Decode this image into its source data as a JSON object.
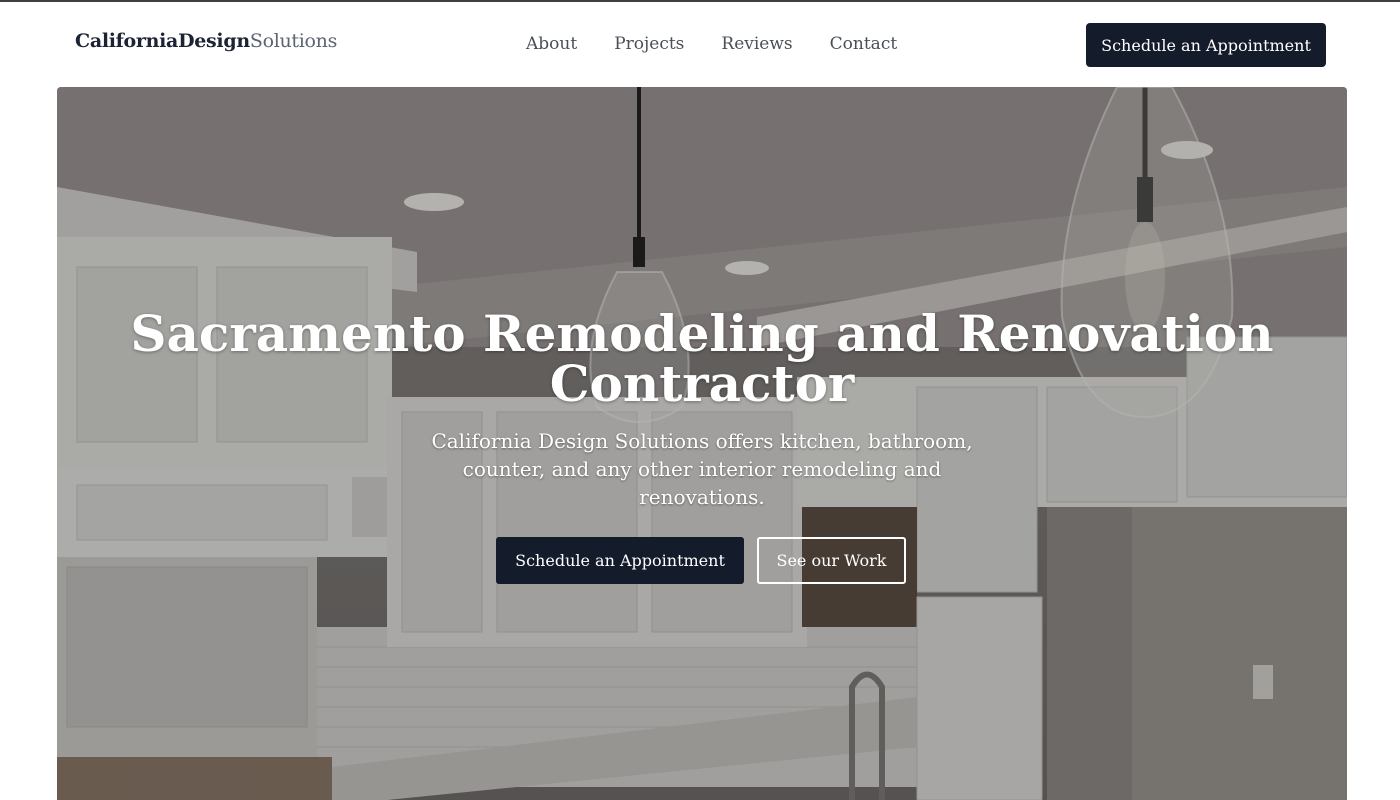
{
  "brand": {
    "part1": "CaliforniaDesign",
    "part2": "Solutions"
  },
  "nav": {
    "items": [
      "About",
      "Projects",
      "Reviews",
      "Contact"
    ]
  },
  "header": {
    "cta_label": "Schedule an Appointment"
  },
  "hero": {
    "title_line1": "Sacramento Remodeling and Renovation",
    "title_line2": "Contractor",
    "subtitle": "California Design Solutions offers kitchen, bathroom, counter, and any other interior remodeling and renovations.",
    "primary_button": "Schedule an Appointment",
    "secondary_button": "See our Work"
  },
  "colors": {
    "dark": "#141b2b",
    "white": "#ffffff",
    "nav_text": "#4a4f57"
  }
}
